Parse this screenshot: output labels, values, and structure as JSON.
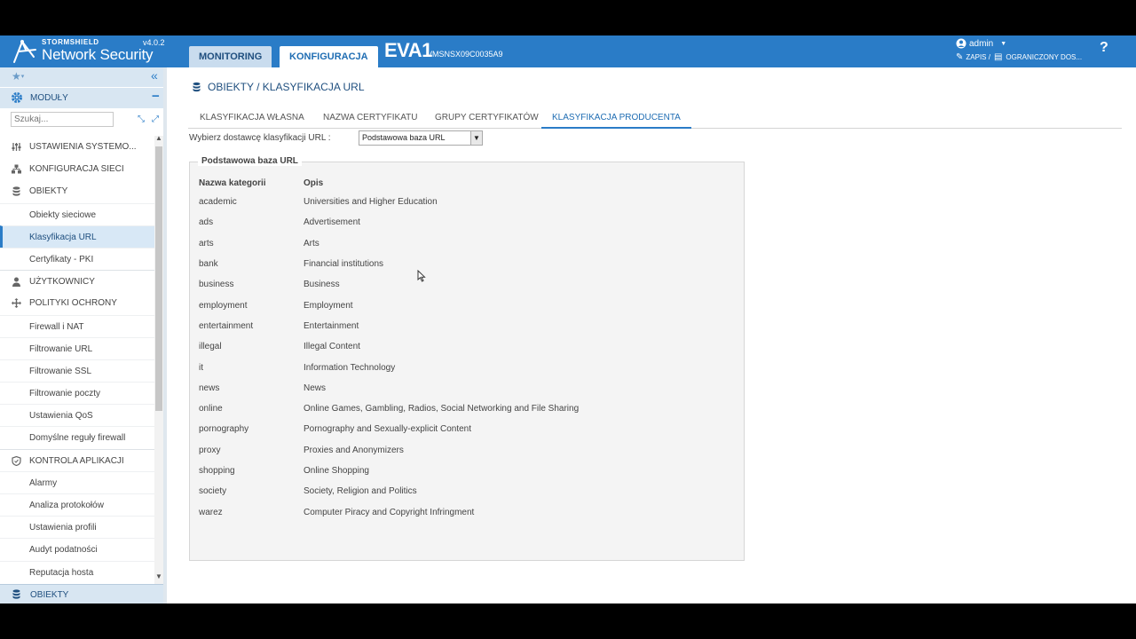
{
  "header": {
    "brand": "STORMSHIELD",
    "product": "Network Security",
    "version": "v4.0.2",
    "tabs": [
      {
        "label": "MONITORING",
        "active": false
      },
      {
        "label": "KONFIGURACJA",
        "active": true
      }
    ],
    "firewall_name": "EVA1",
    "serial": "VMSNSX09C0035A9",
    "user": "admin",
    "access_write": "ZAPIS /",
    "access_limited": "OGRANICZONY DOS...",
    "help": "?",
    "color_bar": "#2a7cc7"
  },
  "sidebar": {
    "modules_label": "MODUŁY",
    "search_placeholder": "Szukaj...",
    "items": [
      {
        "label": "USTAWIENIA SYSTEMO...",
        "icon": "sliders-icon"
      },
      {
        "label": "KONFIGURACJA SIECI",
        "icon": "network-icon"
      },
      {
        "label": "OBIEKTY",
        "icon": "database-icon"
      },
      {
        "label": "Obiekty sieciowe"
      },
      {
        "label": "Klasyfikacja URL",
        "active": true
      },
      {
        "label": "Certyfikaty - PKI"
      },
      {
        "label": "UŻYTKOWNICY",
        "icon": "user-icon"
      },
      {
        "label": "POLITYKI OCHRONY",
        "icon": "arrows-icon"
      },
      {
        "label": "Firewall i NAT"
      },
      {
        "label": "Filtrowanie URL"
      },
      {
        "label": "Filtrowanie SSL"
      },
      {
        "label": "Filtrowanie poczty"
      },
      {
        "label": "Ustawienia QoS"
      },
      {
        "label": "Domyślne reguły firewall"
      },
      {
        "label": "KONTROLA APLIKACJI",
        "icon": "shield-icon"
      },
      {
        "label": "Alarmy"
      },
      {
        "label": "Analiza protokołów"
      },
      {
        "label": "Ustawienia profili"
      },
      {
        "label": "Audyt podatności"
      },
      {
        "label": "Reputacja hosta"
      }
    ],
    "bottom_label": "OBIEKTY"
  },
  "main": {
    "breadcrumb": "OBIEKTY / KLASYFIKACJA URL",
    "tabs": [
      {
        "label": "KLASYFIKACJA WŁASNA",
        "active": false
      },
      {
        "label": "NAZWA CERTYFIKATU",
        "active": false
      },
      {
        "label": "GRUPY CERTYFIKATÓW",
        "active": false
      },
      {
        "label": "KLASYFIKACJA PRODUCENTA",
        "active": true
      }
    ],
    "provider_label": "Wybierz dostawcę klasyfikacji URL :",
    "provider_value": "Podstawowa baza URL",
    "fieldset_title": "Podstawowa baza URL",
    "columns": [
      "Nazwa kategorii",
      "Opis"
    ],
    "rows": [
      [
        "academic",
        "Universities and Higher Education"
      ],
      [
        "ads",
        "Advertisement"
      ],
      [
        "arts",
        "Arts"
      ],
      [
        "bank",
        "Financial institutions"
      ],
      [
        "business",
        "Business"
      ],
      [
        "employment",
        "Employment"
      ],
      [
        "entertainment",
        "Entertainment"
      ],
      [
        "illegal",
        "Illegal Content"
      ],
      [
        "it",
        "Information Technology"
      ],
      [
        "news",
        "News"
      ],
      [
        "online",
        "Online Games, Gambling, Radios, Social Networking and File Sharing"
      ],
      [
        "pornography",
        "Pornography and Sexually-explicit Content"
      ],
      [
        "proxy",
        "Proxies and Anonymizers"
      ],
      [
        "shopping",
        "Online Shopping"
      ],
      [
        "society",
        "Society, Religion and Politics"
      ],
      [
        "warez",
        "Computer Piracy and Copyright Infringment"
      ]
    ]
  }
}
